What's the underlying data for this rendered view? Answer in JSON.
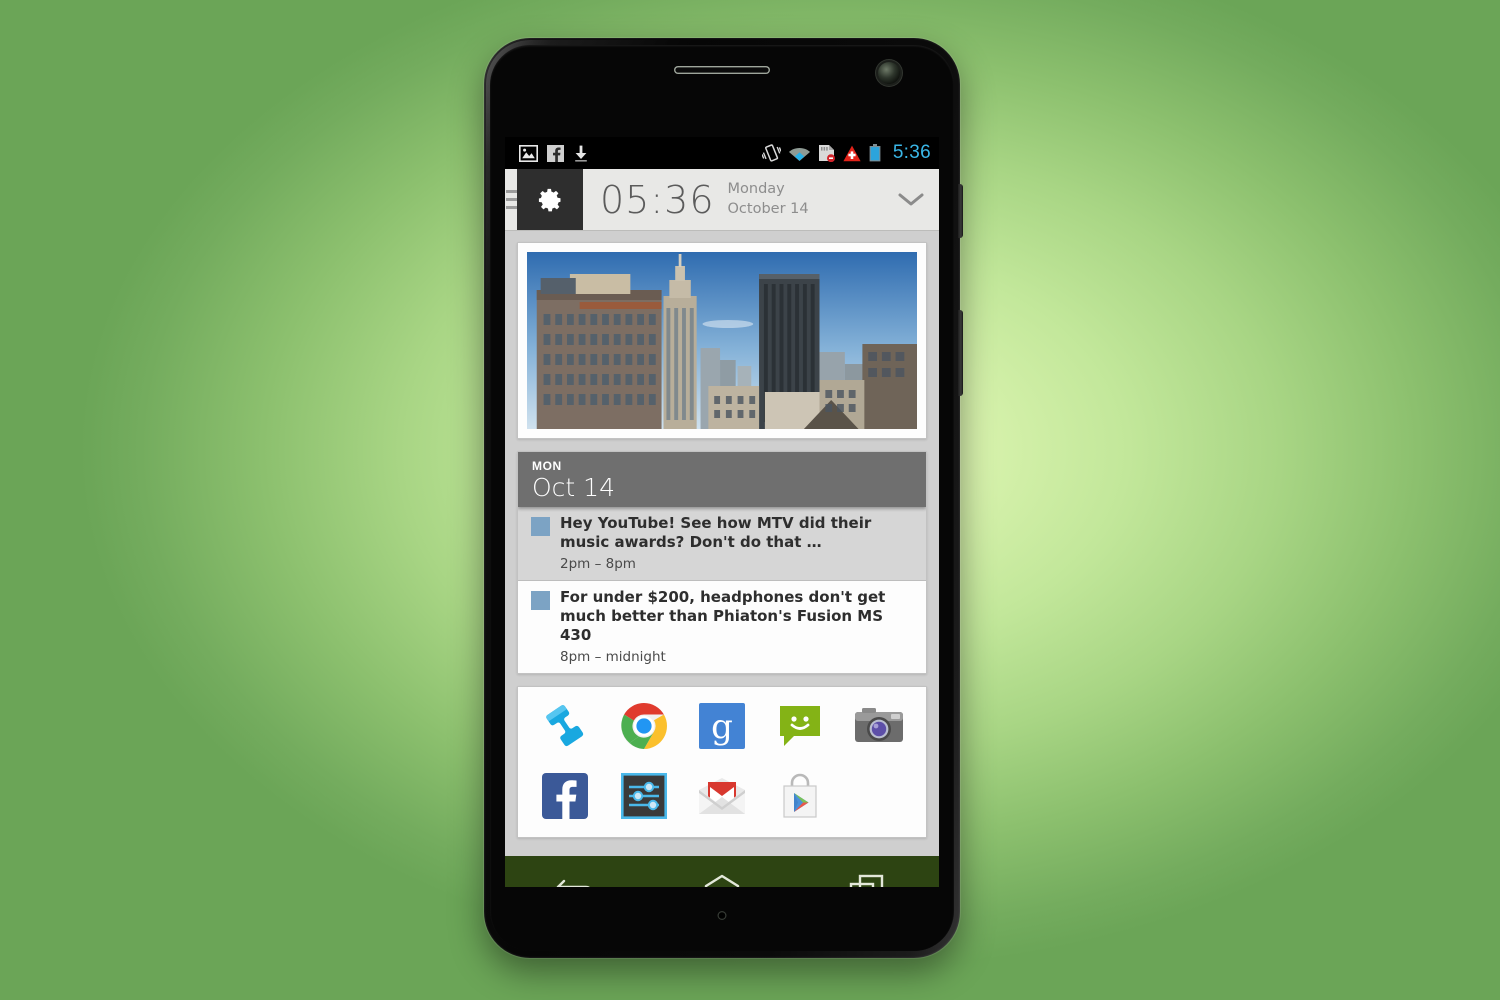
{
  "device": {
    "name": "android-smartphone",
    "earpiece": "earpiece-speaker",
    "front_camera": "front-camera",
    "microphone": "microphone-hole",
    "buttons": [
      "power-button",
      "volume-rocker"
    ]
  },
  "background": {
    "accent_edge": "#6ba557",
    "accent_center": "#e2f7bd"
  },
  "status_bar": {
    "background": "#000000",
    "clock": "5:36",
    "clock_color": "#3ab7e8",
    "left_icons": [
      "image-icon",
      "facebook-icon",
      "download-icon"
    ],
    "right_icons": [
      "vibrate-icon",
      "wifi-icon",
      "sd-card-icon",
      "warning-icon",
      "battery-icon"
    ]
  },
  "clock_widget": {
    "menu_icon": "hamburger-icon",
    "settings_icon": "gear-icon",
    "settings_bg": "#2e2e2e",
    "time": "05:36",
    "day": "Monday",
    "date": "October 14",
    "expand_icon": "chevron-down-icon"
  },
  "photo_widget": {
    "label": "city-skyline-photo",
    "description": "Daytime photo of a Manhattan skyline with the Empire State Building"
  },
  "agenda_widget": {
    "header": {
      "day_of_week": "MON",
      "date": "Oct 14",
      "background": "#6f6f6f"
    },
    "events": [
      {
        "chip_color": "#7ca3c4",
        "title": "Hey YouTube! See how MTV did their music awards? Don't do that …",
        "time": "2pm – 8pm",
        "selected": true
      },
      {
        "chip_color": "#7ca3c4",
        "title": "For under $200, headphones don't get much better than Phiaton's Fusion MS 430",
        "time": "8pm – midnight",
        "selected": false
      }
    ]
  },
  "app_grid": {
    "rows": [
      [
        {
          "name": "phone-app-icon",
          "label": "Phone"
        },
        {
          "name": "chrome-app-icon",
          "label": "Chrome"
        },
        {
          "name": "google-app-icon",
          "label": "Google"
        },
        {
          "name": "messaging-app-icon",
          "label": "Messaging"
        },
        {
          "name": "camera-app-icon",
          "label": "Camera"
        }
      ],
      [
        {
          "name": "facebook-app-icon",
          "label": "Facebook"
        },
        {
          "name": "settings-app-icon",
          "label": "Settings"
        },
        {
          "name": "gmail-app-icon",
          "label": "Gmail"
        },
        {
          "name": "play-store-app-icon",
          "label": "Play Store"
        }
      ]
    ]
  },
  "nav_bar": {
    "background": "#2d4412",
    "buttons": [
      {
        "name": "back-button",
        "label": "Back"
      },
      {
        "name": "home-button",
        "label": "Home"
      },
      {
        "name": "recents-button",
        "label": "Recent apps"
      }
    ]
  }
}
